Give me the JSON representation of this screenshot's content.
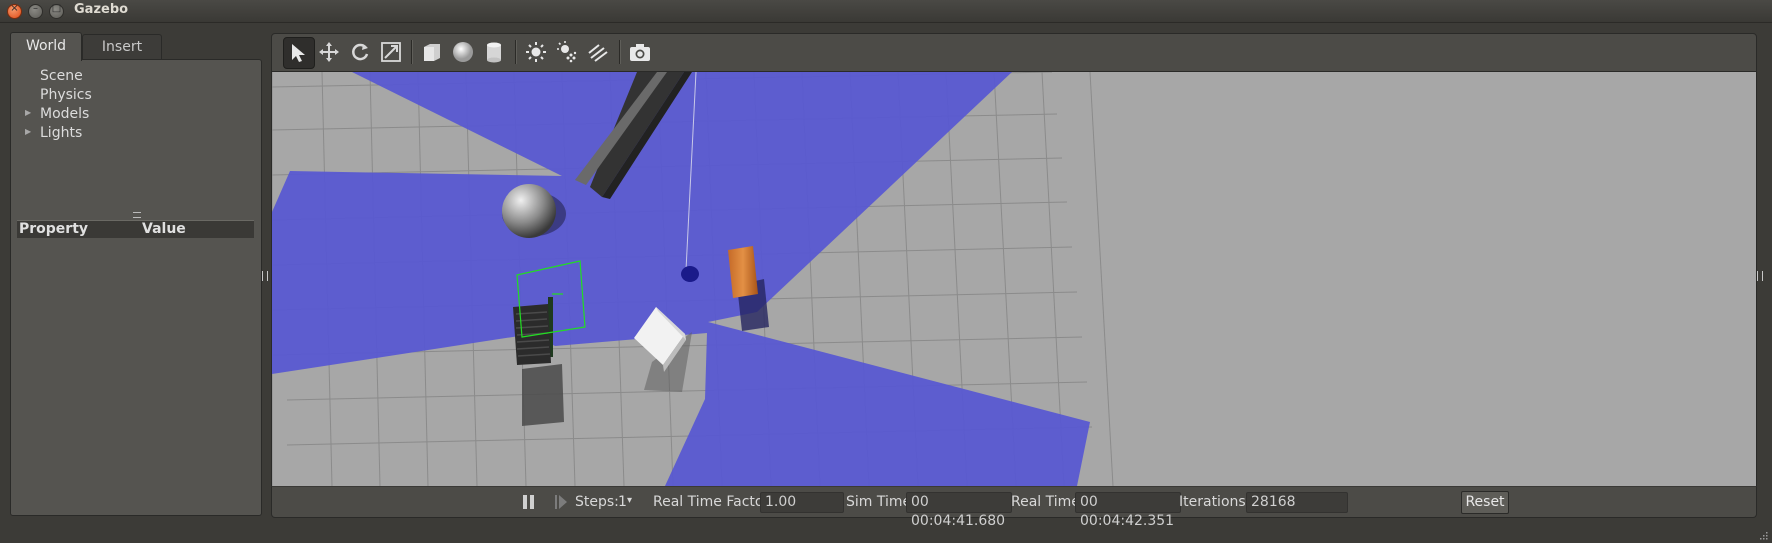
{
  "window": {
    "title": "Gazebo"
  },
  "left_panel": {
    "tabs": [
      {
        "label": "World",
        "active": true
      },
      {
        "label": "Insert",
        "active": false
      }
    ],
    "tree_items": [
      {
        "label": "Scene",
        "expandable": false
      },
      {
        "label": "Physics",
        "expandable": false
      },
      {
        "label": "Models",
        "expandable": true
      },
      {
        "label": "Lights",
        "expandable": true
      }
    ],
    "property_table": {
      "columns": [
        "Property",
        "Value"
      ]
    }
  },
  "toolbar": {
    "tools": [
      {
        "icon": "select-arrow-icon",
        "active": true
      },
      {
        "icon": "translate-icon"
      },
      {
        "icon": "rotate-icon"
      },
      {
        "icon": "scale-icon"
      },
      {
        "icon": "box-shape-icon"
      },
      {
        "icon": "sphere-shape-icon"
      },
      {
        "icon": "cylinder-shape-icon"
      },
      {
        "icon": "point-light-icon"
      },
      {
        "icon": "spot-light-icon"
      },
      {
        "icon": "directional-light-icon"
      },
      {
        "icon": "screenshot-camera-icon"
      }
    ]
  },
  "bottom_bar": {
    "steps_label": "Steps:",
    "steps_value": "1",
    "rtf_label": "Real Time Factor:",
    "rtf_value": "1.00",
    "sim_time_label": "Sim Time:",
    "sim_time_value": "00 00:04:41.680",
    "real_time_label": "Real Time:",
    "real_time_value": "00 00:04:42.351",
    "iterations_label": "Iterations:",
    "iterations_value": "28168",
    "reset_label": "Reset"
  },
  "colors": {
    "laser_scan": "#5757d2",
    "ground": "#a7a7a7",
    "selection_box": "#22dd22",
    "panel_bg": "#555450",
    "window_bg": "#3c3b37"
  }
}
